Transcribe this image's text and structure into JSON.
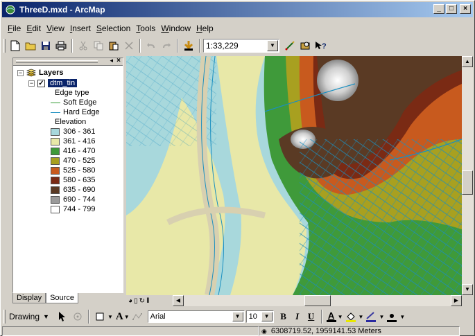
{
  "window": {
    "title": "ThreeD.mxd - ArcMap",
    "minimize": "_",
    "maximize": "□",
    "close": "×"
  },
  "menu": [
    {
      "ul": "F",
      "rest": "ile"
    },
    {
      "ul": "E",
      "rest": "dit"
    },
    {
      "ul": "V",
      "rest": "iew"
    },
    {
      "ul": "I",
      "rest": "nsert"
    },
    {
      "ul": "S",
      "rest": "election"
    },
    {
      "ul": "T",
      "rest": "ools"
    },
    {
      "ul": "W",
      "rest": "indow"
    },
    {
      "ul": "H",
      "rest": "elp"
    }
  ],
  "toolbar": {
    "scale": "1:33,229"
  },
  "toc": {
    "root": "Layers",
    "layer": "dtm_tin",
    "edge_heading": "Edge type",
    "edges": [
      {
        "label": "Soft Edge",
        "color": "#2f9a2f"
      },
      {
        "label": "Hard Edge",
        "color": "#1a8fc0"
      }
    ],
    "elev_heading": "Elevation",
    "elevation": [
      {
        "label": "306 - 361",
        "color": "#a8d8dc"
      },
      {
        "label": "361 - 416",
        "color": "#e8e8a8"
      },
      {
        "label": "416 - 470",
        "color": "#3f9a3a"
      },
      {
        "label": "470 - 525",
        "color": "#a8a020"
      },
      {
        "label": "525 - 580",
        "color": "#c85a1e"
      },
      {
        "label": "580 - 635",
        "color": "#7a2a14"
      },
      {
        "label": "635 - 690",
        "color": "#5a3a24"
      },
      {
        "label": "690 - 744",
        "color": "#9a9a9a"
      },
      {
        "label": "744 - 799",
        "color": "#ffffff"
      }
    ],
    "tabs": {
      "display": "Display",
      "source": "Source"
    }
  },
  "drawing": {
    "label": "Drawing",
    "font": "Arial",
    "size": "10",
    "bold": "B",
    "italic": "I",
    "underline": "U",
    "text_a": "A"
  },
  "status": {
    "coords": "6308719.52, 1959141.53 Meters"
  }
}
